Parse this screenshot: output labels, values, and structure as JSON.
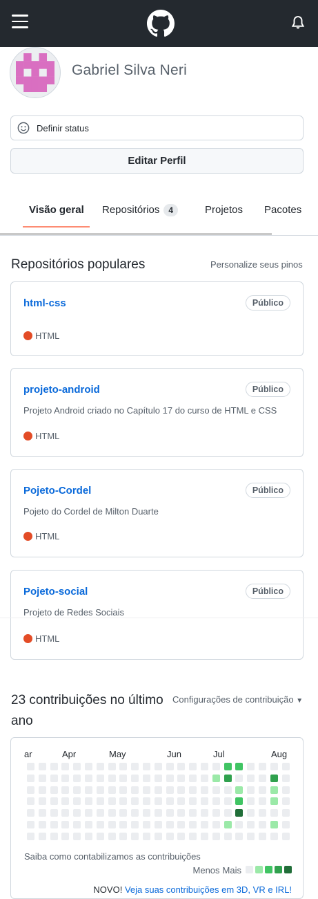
{
  "header": {
    "menu_icon": "hamburger-menu-icon",
    "logo_icon": "github-octocat-icon",
    "notification_icon": "bell-icon"
  },
  "profile": {
    "name": "Gabriel Silva Neri",
    "status_label": "Definir status",
    "edit_label": "Editar Perfil",
    "avatar_color": "#d96fc1"
  },
  "tabs": [
    {
      "label": "Visão geral",
      "active": true
    },
    {
      "label": "Repositórios",
      "count": "4"
    },
    {
      "label": "Projetos"
    },
    {
      "label": "Pacotes"
    }
  ],
  "popular": {
    "title": "Repositórios populares",
    "customize": "Personalize seus pinos",
    "repos": [
      {
        "name": "html-css",
        "visibility": "Público",
        "description": "",
        "language": "HTML"
      },
      {
        "name": "projeto-android",
        "visibility": "Público",
        "description": "Projeto Android criado no Capítulo 17 do curso de HTML e CSS",
        "language": "HTML"
      },
      {
        "name": "Pojeto-Cordel",
        "visibility": "Público",
        "description": "Pojeto do Cordel de Milton Duarte",
        "language": "HTML"
      },
      {
        "name": "Pojeto-social",
        "visibility": "Público",
        "description": "Projeto de Redes Sociais",
        "language": "HTML"
      }
    ],
    "language_color": "#e34c26"
  },
  "contributions": {
    "title": "23 contribuições no último ano",
    "settings": "Configurações de contribuição",
    "months": [
      "ar",
      "Apr",
      "May",
      "Jun",
      "Jul",
      "Aug"
    ],
    "learn_more": "Saiba como contabilizamos as contribuições",
    "legend_less": "Menos",
    "legend_more": "Mais",
    "new_label": "NOVO!",
    "new_link": "Veja suas contribuições em 3D, VR e IRL!",
    "colors": [
      "#ebedf0",
      "#9be9a8",
      "#40c463",
      "#30a14e",
      "#216e39"
    ],
    "levels": [
      [
        0,
        0,
        0,
        0,
        0,
        0,
        0
      ],
      [
        0,
        0,
        0,
        0,
        0,
        0,
        0
      ],
      [
        0,
        0,
        0,
        0,
        0,
        0,
        0
      ],
      [
        0,
        0,
        0,
        0,
        0,
        0,
        0
      ],
      [
        0,
        0,
        0,
        0,
        0,
        0,
        0
      ],
      [
        0,
        0,
        0,
        0,
        0,
        0,
        0
      ],
      [
        0,
        0,
        0,
        0,
        0,
        0,
        0
      ],
      [
        0,
        0,
        0,
        0,
        0,
        0,
        0
      ],
      [
        0,
        0,
        0,
        0,
        0,
        0,
        0
      ],
      [
        0,
        0,
        0,
        0,
        0,
        0,
        0
      ],
      [
        0,
        0,
        0,
        0,
        0,
        0,
        0
      ],
      [
        0,
        0,
        0,
        0,
        0,
        0,
        0
      ],
      [
        0,
        0,
        0,
        0,
        0,
        0,
        0
      ],
      [
        0,
        0,
        0,
        0,
        0,
        0,
        0
      ],
      [
        0,
        0,
        0,
        0,
        0,
        0,
        0
      ],
      [
        0,
        0,
        0,
        0,
        0,
        0,
        0
      ],
      [
        0,
        1,
        0,
        0,
        0,
        0,
        0
      ],
      [
        2,
        3,
        0,
        0,
        0,
        1,
        0
      ],
      [
        2,
        0,
        1,
        2,
        4,
        0,
        0
      ],
      [
        0,
        0,
        0,
        0,
        0,
        0,
        0
      ],
      [
        0,
        0,
        0,
        0,
        0,
        0,
        0
      ],
      [
        0,
        3,
        1,
        1,
        0,
        1,
        0
      ],
      [
        0,
        0,
        0,
        0,
        0,
        0,
        0
      ]
    ]
  }
}
